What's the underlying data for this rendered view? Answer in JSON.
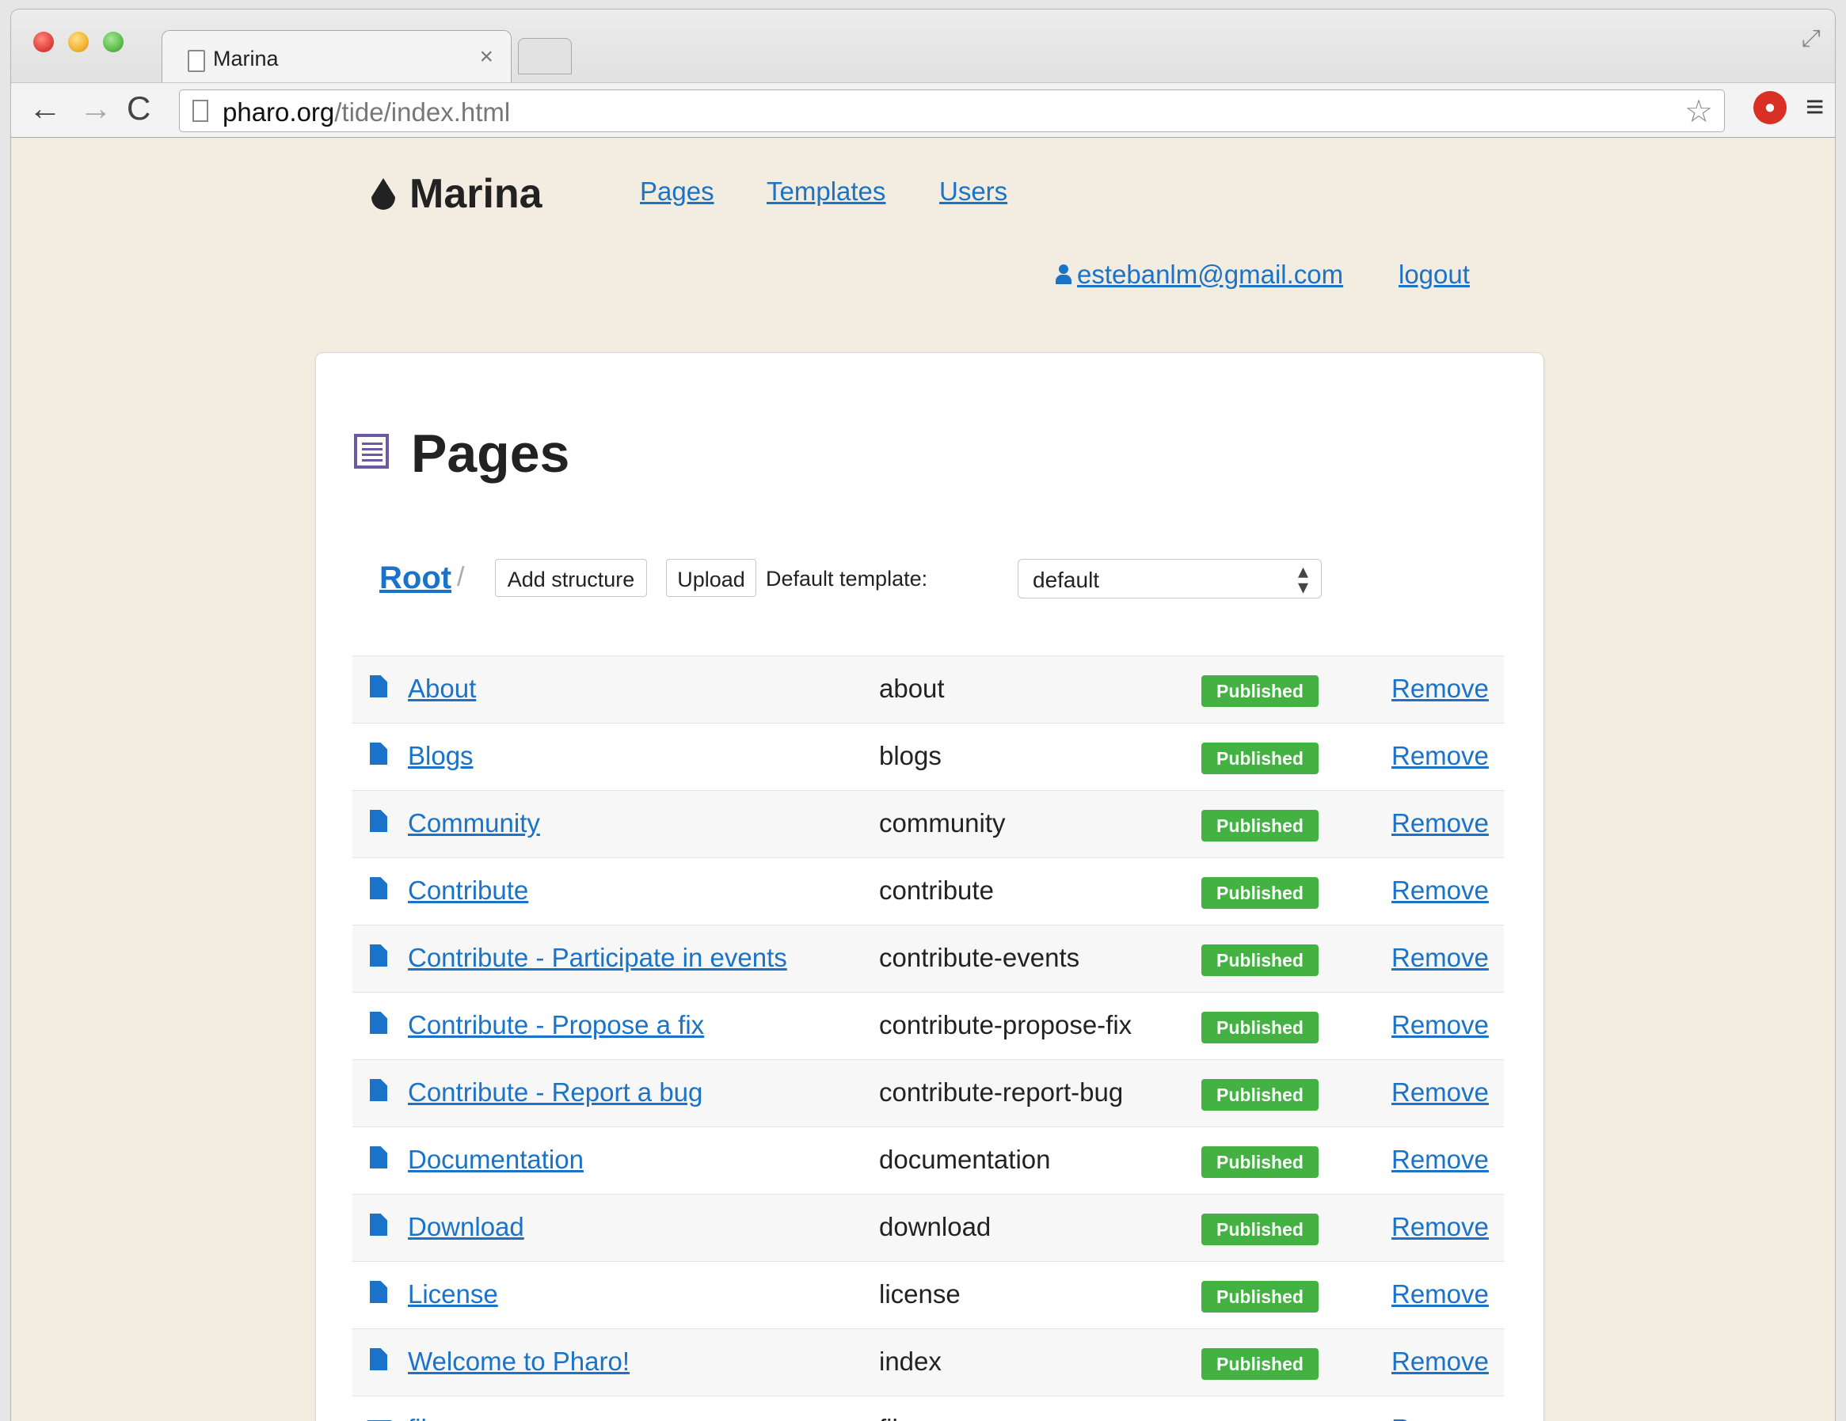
{
  "browser": {
    "tab_title": "Marina",
    "tab_close": "×",
    "url_host": "pharo.org",
    "url_path": "/tide/index.html",
    "back": "←",
    "forward": "→",
    "reload": "C",
    "star": "☆",
    "menu": "≡",
    "fullscreen": "⤢"
  },
  "site": {
    "logo_text": "Marina",
    "nav": [
      "Pages",
      "Templates",
      "Users"
    ],
    "user_email": "estebanlm@gmail.com",
    "logout": "logout"
  },
  "card": {
    "title": "Pages",
    "root_label": "Root",
    "slash": "/",
    "add_structure": "Add structure",
    "upload": "Upload",
    "default_template_label": "Default template:",
    "default_template_value": "default",
    "select_arrow": "▲▼"
  },
  "rows": [
    {
      "name": "About",
      "slug": "about",
      "status": "Published",
      "action": "Remove",
      "icon": "file-icon"
    },
    {
      "name": "Blogs",
      "slug": "blogs",
      "status": "Published",
      "action": "Remove",
      "icon": "file-icon"
    },
    {
      "name": "Community",
      "slug": "community",
      "status": "Published",
      "action": "Remove",
      "icon": "file-icon"
    },
    {
      "name": "Contribute",
      "slug": "contribute",
      "status": "Published",
      "action": "Remove",
      "icon": "file-icon"
    },
    {
      "name": "Contribute - Participate in events",
      "slug": "contribute-events",
      "status": "Published",
      "action": "Remove",
      "icon": "file-icon"
    },
    {
      "name": "Contribute - Propose a fix",
      "slug": "contribute-propose-fix",
      "status": "Published",
      "action": "Remove",
      "icon": "file-icon"
    },
    {
      "name": "Contribute - Report a bug",
      "slug": "contribute-report-bug",
      "status": "Published",
      "action": "Remove",
      "icon": "file-icon"
    },
    {
      "name": "Documentation",
      "slug": "documentation",
      "status": "Published",
      "action": "Remove",
      "icon": "file-icon"
    },
    {
      "name": "Download",
      "slug": "download",
      "status": "Published",
      "action": "Remove",
      "icon": "file-icon"
    },
    {
      "name": "License",
      "slug": "license",
      "status": "Published",
      "action": "Remove",
      "icon": "file-icon"
    },
    {
      "name": "Welcome to Pharo!",
      "slug": "index",
      "status": "Published",
      "action": "Remove",
      "icon": "file-icon"
    },
    {
      "name": "files",
      "slug": "files",
      "status": "",
      "action": "Remove",
      "icon": "folder-icon"
    }
  ],
  "colors": {
    "link": "#1a73c8",
    "badge": "#43b243",
    "page_bg": "#f2ede0",
    "pages_icon": "#6b5aa0"
  }
}
